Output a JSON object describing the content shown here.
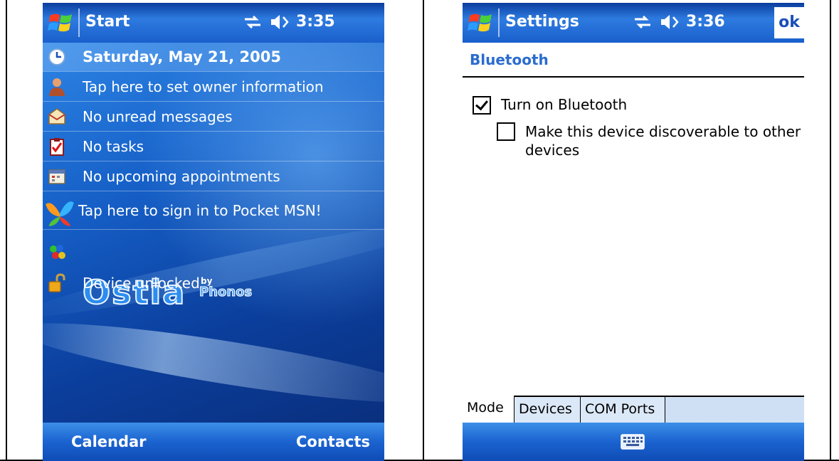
{
  "left_device": {
    "titlebar": {
      "title": "Start",
      "time": "3:35"
    },
    "today": {
      "date": "Saturday, May 21, 2005",
      "owner": "Tap here to set owner information",
      "messages": "No unread messages",
      "tasks": "No tasks",
      "appointments": "No upcoming appointments",
      "msn": "Tap here to sign in to Pocket MSN!",
      "plugin_brand": "Ostia",
      "plugin_by": "by",
      "plugin_maker": "Phonos",
      "device_lock": "Device unlocked"
    },
    "softkeys": {
      "left": "Calendar",
      "right": "Contacts"
    }
  },
  "right_device": {
    "titlebar": {
      "title": "Settings",
      "time": "3:36",
      "ok": "ok"
    },
    "section_title": "Bluetooth",
    "turn_on": {
      "label": "Turn on Bluetooth",
      "checked": true
    },
    "discoverable": {
      "label_line1": "Make this device discoverable to other",
      "label_line2": "devices",
      "checked": false
    },
    "tabs": [
      "Mode",
      "Devices",
      "COM Ports"
    ],
    "active_tab": "Mode"
  },
  "colors": {
    "titlebar": "#1a5fcc",
    "today_bg": "#1660c8",
    "section_title": "#2a6ccf",
    "tab_bg": "#dbe8f7"
  }
}
